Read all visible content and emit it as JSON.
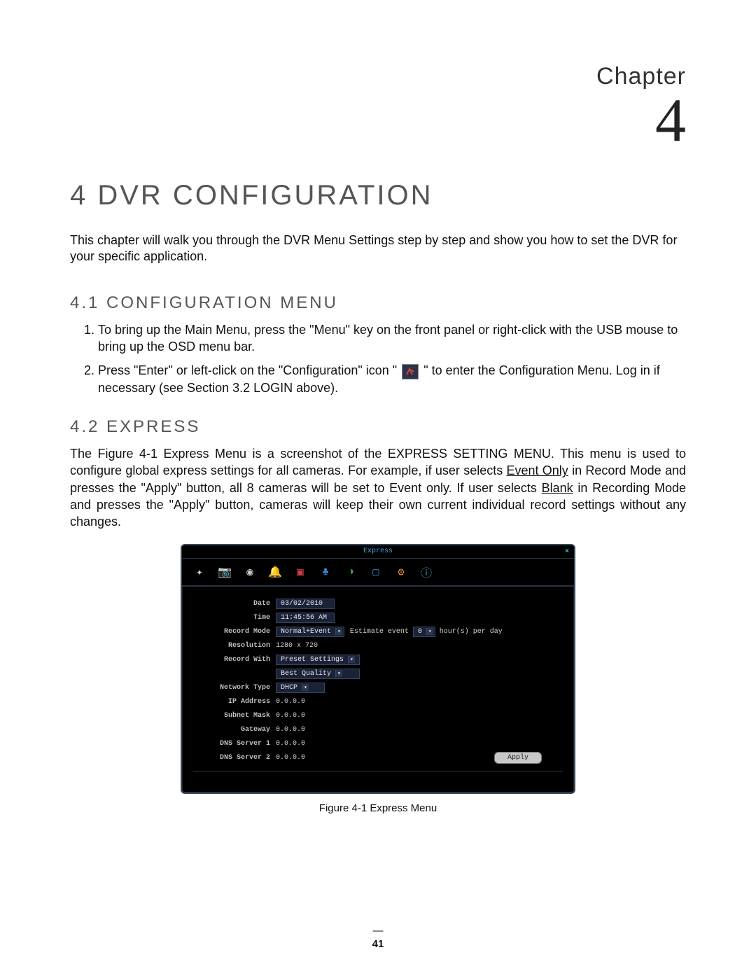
{
  "chapter": {
    "label": "Chapter",
    "number": "4"
  },
  "title": "4  DVR CONFIGURATION",
  "intro": "This chapter will walk you through the DVR Menu Settings step by step and show you how to set the DVR for your specific application.",
  "section41": {
    "heading": "4.1 CONFIGURATION MENU",
    "step1_a": "To bring up the Main Menu, press the \"",
    "step1_menu": "Menu",
    "step1_b": "\" key on the front panel or right-click with the USB mouse to bring up the OSD menu bar.",
    "step2_a": "Press \"",
    "step2_enter": "Enter",
    "step2_b": "\" or left-click on the \"Configuration\" icon \"",
    "step2_c": "\" to enter the Configuration Menu. Log in if necessary (see Section 3.2 LOGIN above)."
  },
  "section42": {
    "heading": "4.2 EXPRESS",
    "para_a": "The Figure 4-1 Express Menu is a screenshot of the ",
    "para_b": "EXPRESS SETTING MENU",
    "para_c": ". This menu is used to configure global express settings for all cameras. For example, if user selects ",
    "para_eventonly": "Event Only",
    "para_d": " in Record Mode and presses the \"Apply\" button, all 8 cameras will be set to Event only. If user selects ",
    "para_blank": "Blank",
    "para_e": " in Recording Mode and presses the \"Apply\" button, cameras will keep their own current individual record settings without any changes."
  },
  "screenshot": {
    "title": "Express",
    "icons": [
      {
        "name": "express-icon",
        "glyph": "✦",
        "color": "#d0d0d0"
      },
      {
        "name": "camera-icon",
        "glyph": "📷",
        "color": "#aaa"
      },
      {
        "name": "record-icon",
        "glyph": "◉",
        "color": "#c8c8c8"
      },
      {
        "name": "alarm-icon",
        "glyph": "🔔",
        "color": "#e0b040"
      },
      {
        "name": "display-red-icon",
        "glyph": "▣",
        "color": "#d04040"
      },
      {
        "name": "network-icon",
        "glyph": "♣",
        "color": "#3a80d0"
      },
      {
        "name": "schedule-icon",
        "glyph": "◑",
        "color": "#40a040"
      },
      {
        "name": "display-icon",
        "glyph": "▢",
        "color": "#3a80d0"
      },
      {
        "name": "system-icon",
        "glyph": "⚙",
        "color": "#d08a30"
      },
      {
        "name": "info-icon",
        "glyph": "ⓘ",
        "color": "#30a0c0"
      }
    ],
    "rows": {
      "date": {
        "label": "Date",
        "value": "03/02/2010"
      },
      "time": {
        "label": "Time",
        "value": "11:45:56 AM"
      },
      "record_mode": {
        "label": "Record Mode",
        "value": "Normal+Event",
        "extra_a": "Estimate event",
        "extra_val": "0",
        "extra_b": "hour(s) per day"
      },
      "resolution": {
        "label": "Resolution",
        "value": "1280 x 720"
      },
      "record_with": {
        "label": "Record With",
        "value": "Preset Settings",
        "value2": "Best Quality"
      },
      "network_type": {
        "label": "Network Type",
        "value": "DHCP"
      },
      "ip_address": {
        "label": "IP Address",
        "value": "0.0.0.0"
      },
      "subnet_mask": {
        "label": "Subnet Mask",
        "value": "0.0.0.0"
      },
      "gateway": {
        "label": "Gateway",
        "value": "0.0.0.0"
      },
      "dns1": {
        "label": "DNS Server 1",
        "value": "0.0.0.0"
      },
      "dns2": {
        "label": "DNS Server 2",
        "value": "0.0.0.0"
      }
    },
    "apply": "Apply"
  },
  "figure_caption": "Figure 4-1 Express Menu",
  "page_number": "41"
}
